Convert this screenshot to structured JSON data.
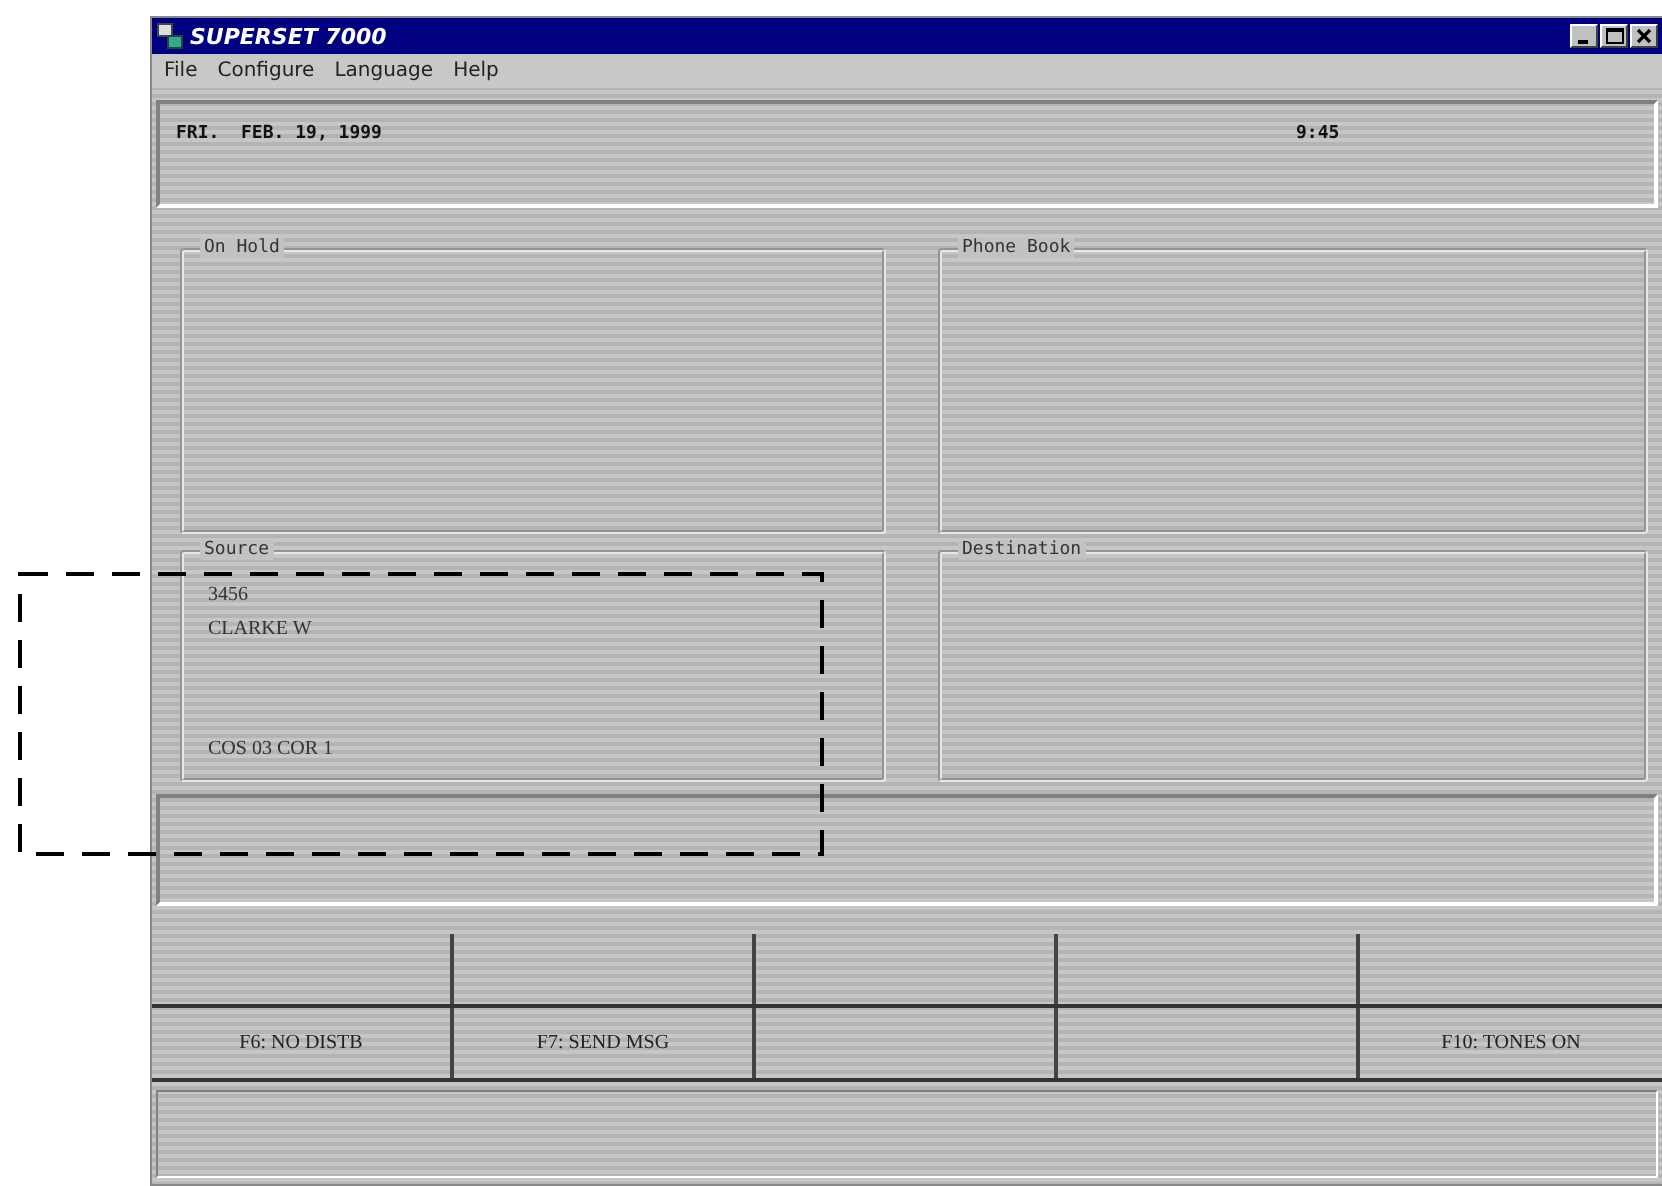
{
  "window": {
    "title": "SUPERSET 7000"
  },
  "menu": [
    "File",
    "Configure",
    "Language",
    "Help"
  ],
  "display": {
    "date": "FRI.  FEB. 19, 1999",
    "time": "9:45"
  },
  "groups": [
    {
      "title": "On Hold"
    },
    {
      "title": "Phone Book"
    },
    {
      "title": "Source",
      "lines": [
        "3456",
        "CLARKE W"
      ],
      "footer": "COS 03  COR 1",
      "highlighted": true
    },
    {
      "title": "Destination"
    }
  ],
  "key_rows": [
    {
      "keys": [
        {
          "kind": "blank"
        },
        {
          "kind": "blank"
        },
        {
          "kind": "blank"
        },
        {
          "kind": "blank"
        },
        {
          "kind": "blank"
        }
      ]
    },
    {
      "keys": [
        {
          "kind": "labeled",
          "label": "F6: NO DISTB"
        },
        {
          "kind": "labeled",
          "label": "F7: SEND MSG"
        },
        {
          "kind": "blank"
        },
        {
          "kind": "blank"
        },
        {
          "kind": "labeled",
          "label": "F10: TONES ON"
        }
      ]
    }
  ]
}
